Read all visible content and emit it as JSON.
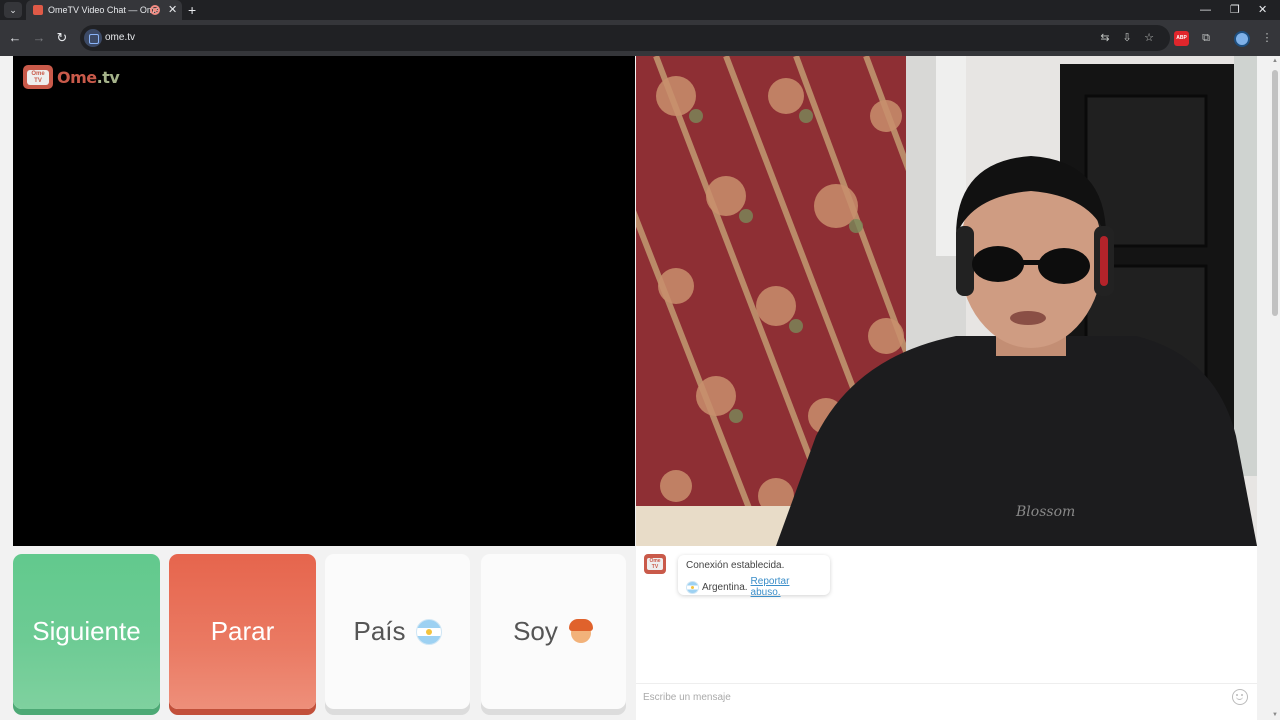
{
  "browser": {
    "tab_title": "OmeTV Video Chat — Ome",
    "url": "ome.tv",
    "tab_list_icon": "chevron-down-icon",
    "new_tab_icon": "plus-icon"
  },
  "logo": {
    "brand_main": "Ome",
    "brand_dot": ".tv",
    "badge_text": "Ome TV"
  },
  "buttons": {
    "next_label": "Siguiente",
    "stop_label": "Parar",
    "country_label": "País",
    "soy_label": "Soy"
  },
  "chat": {
    "status": "Conexión establecida.",
    "country": "Argentina.",
    "report_link": "Reportar abuso.",
    "input_placeholder": "Escribe un mensaje"
  },
  "colors": {
    "next_green": "#6dcb94",
    "stop_red": "#ea7a63",
    "brand_red": "#c95a4a",
    "link_blue": "#3a8ec9"
  }
}
